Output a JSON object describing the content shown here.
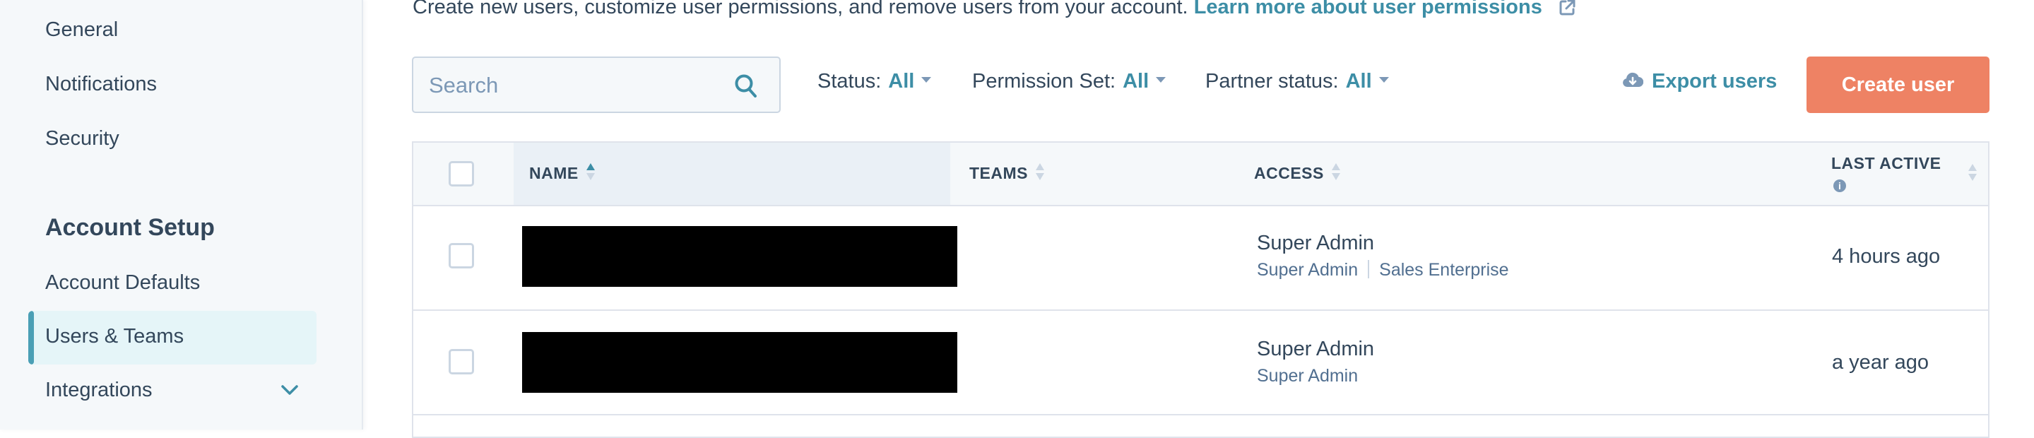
{
  "sidebar": {
    "items": [
      {
        "label": "General"
      },
      {
        "label": "Notifications"
      },
      {
        "label": "Security"
      }
    ],
    "section_heading": "Account Setup",
    "section_items": [
      {
        "label": "Account Defaults",
        "active": false
      },
      {
        "label": "Users & Teams",
        "active": true
      },
      {
        "label": "Integrations",
        "active": false,
        "icon": "chevron-down-icon"
      }
    ]
  },
  "intro": {
    "text": "Create new users, customize user permissions, and remove users from your account.",
    "link_label": "Learn more about user permissions",
    "link_icon": "external-link-icon"
  },
  "toolbar": {
    "search_placeholder": "Search",
    "search_value": "",
    "filters": [
      {
        "label": "Status:",
        "value": "All"
      },
      {
        "label": "Permission Set:",
        "value": "All"
      },
      {
        "label": "Partner status:",
        "value": "All"
      }
    ],
    "export_label": "Export users",
    "export_icon": "cloud-download-icon",
    "create_label": "Create user"
  },
  "table": {
    "columns": [
      {
        "label": "NAME",
        "sort": "ascending"
      },
      {
        "label": "TEAMS",
        "sort": "none"
      },
      {
        "label": "ACCESS",
        "sort": "none"
      },
      {
        "label": "LAST ACTIVE",
        "sort": "none",
        "info_icon": true
      }
    ],
    "rows": [
      {
        "name": "[redacted]",
        "teams": "",
        "access_main": "Super Admin",
        "access_sub": [
          "Super Admin",
          "Sales Enterprise"
        ],
        "last_active": "4 hours ago"
      },
      {
        "name": "[redacted]",
        "teams": "",
        "access_main": "Super Admin",
        "access_sub": [
          "Super Admin"
        ],
        "last_active": "a year ago"
      }
    ]
  },
  "colors": {
    "accent": "#3d8ea6",
    "primary_button": "#ee8264",
    "text": "#33475b",
    "muted": "#7c98b6",
    "sidebar_bg": "#f5f8fa",
    "active_bg": "#e5f5f8"
  }
}
